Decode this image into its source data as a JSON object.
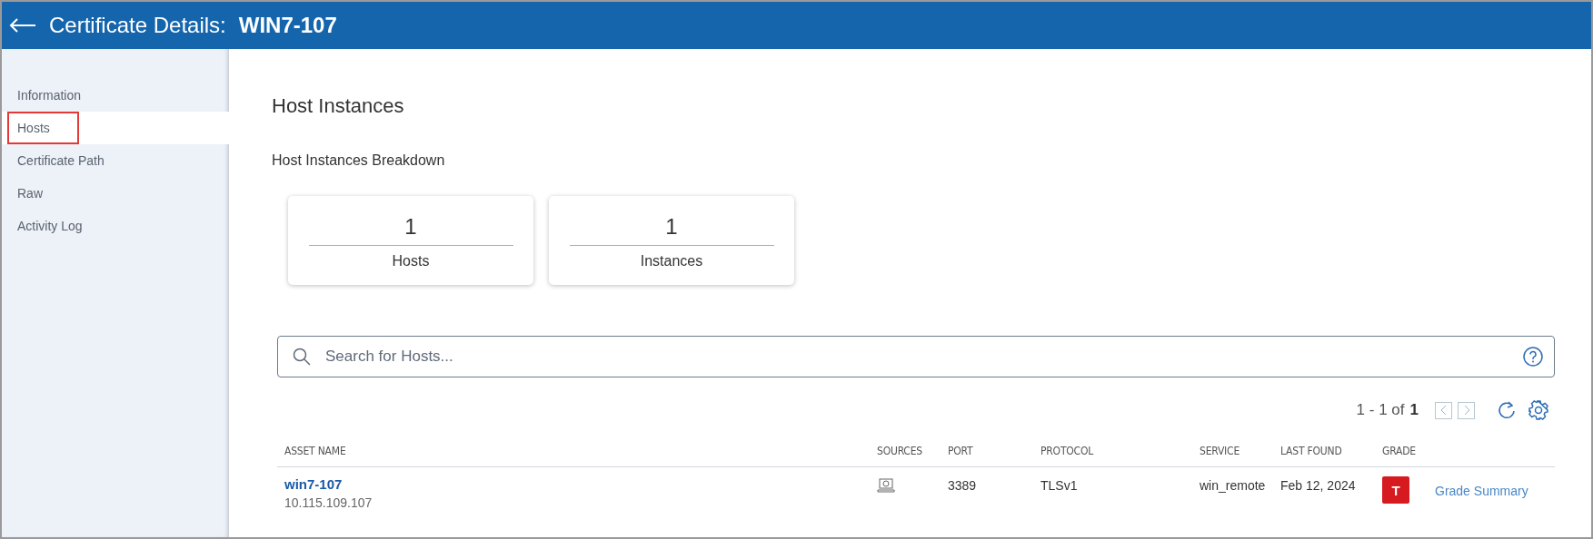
{
  "header": {
    "title": "Certificate Details:",
    "subject": "WIN7-107"
  },
  "sidebar": {
    "items": [
      {
        "label": "Information",
        "selected": false,
        "annotated": false
      },
      {
        "label": "Hosts",
        "selected": true,
        "annotated": true
      },
      {
        "label": "Certificate Path",
        "selected": false,
        "annotated": false
      },
      {
        "label": "Raw",
        "selected": false,
        "annotated": false
      },
      {
        "label": "Activity Log",
        "selected": false,
        "annotated": false
      }
    ]
  },
  "page_title": "Host Instances",
  "breakdown": {
    "title": "Host Instances Breakdown",
    "cards": [
      {
        "value": "1",
        "label": "Hosts"
      },
      {
        "value": "1",
        "label": "Instances"
      }
    ]
  },
  "search": {
    "placeholder": "Search for Hosts..."
  },
  "pagination": {
    "range": "1 - 1 of",
    "total": "1"
  },
  "table": {
    "columns": [
      "ASSET NAME",
      "SOURCES",
      "PORT",
      "PROTOCOL",
      "SERVICE",
      "LAST FOUND",
      "GRADE"
    ],
    "rows": [
      {
        "asset_name": "win7-107",
        "address": "10.115.109.107",
        "port": "3389",
        "protocol": "TLSv1",
        "service": "win_remote",
        "last_found": "Feb 12, 2024",
        "grade": "T",
        "color": "#d71920",
        "link": "Grade Summary"
      }
    ]
  }
}
